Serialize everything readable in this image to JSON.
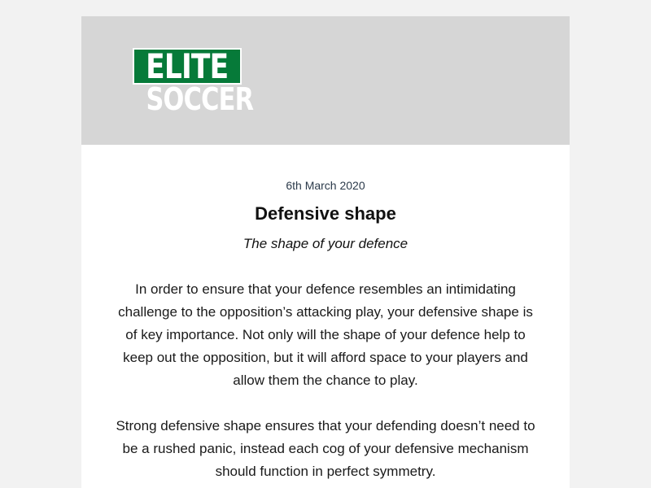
{
  "brand": {
    "logo_top": "ELITE",
    "logo_bottom": "SOCCER",
    "colors": {
      "logo_green": "#067a39",
      "header_bg": "#d6d6d6",
      "page_bg": "#f2f2f2"
    }
  },
  "article": {
    "date": "6th March 2020",
    "title": "Defensive shape",
    "subtitle": "The shape of your defence",
    "paragraphs": [
      "In order to ensure that your defence resembles an intimidating challenge to the opposition’s attacking play, your defensive shape is of key importance. Not only will the shape of your defence help to keep out the opposition, but it will afford space to your players and allow them the chance to play.",
      "Strong defensive shape ensures that your defending doesn’t need to be a rushed panic, instead each cog of your defensive mechanism should function in perfect symmetry."
    ]
  }
}
